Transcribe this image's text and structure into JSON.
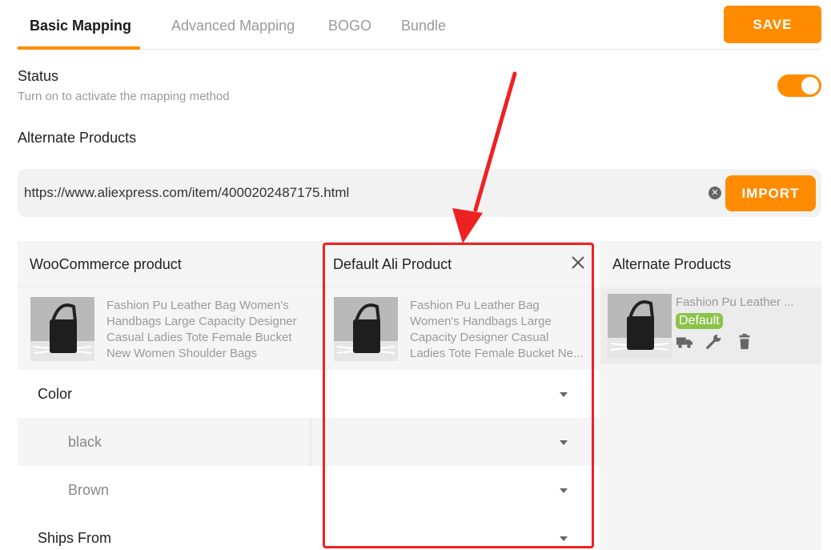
{
  "tabs": [
    {
      "label": "Basic Mapping",
      "active": true
    },
    {
      "label": "Advanced Mapping",
      "active": false
    },
    {
      "label": "BOGO",
      "active": false
    },
    {
      "label": "Bundle",
      "active": false
    }
  ],
  "toolbar": {
    "save_label": "SAVE"
  },
  "status": {
    "title": "Status",
    "description": "Turn on to activate the mapping method",
    "enabled": true
  },
  "alternate_section": {
    "title": "Alternate Products"
  },
  "url_import": {
    "value": "https://www.aliexpress.com/item/4000202487175.html",
    "import_label": "IMPORT"
  },
  "columns": {
    "woo": "WooCommerce product",
    "default_ali": "Default Ali Product",
    "alternate": "Alternate Products"
  },
  "woo_product": {
    "name_lines": [
      "Fashion Pu Leather Bag Women's",
      "Handbags Large Capacity Designer",
      "Casual Ladies Tote Female Bucket",
      "New Women Shoulder Bags"
    ]
  },
  "ali_product": {
    "name_lines": [
      "Fashion Pu Leather Bag",
      "Women's Handbags Large",
      "Capacity Designer Casual",
      "Ladies Tote Female Bucket Ne..."
    ]
  },
  "alternate_item": {
    "name": "Fashion Pu Leather ...",
    "badge": "Default",
    "icons": [
      "truck-icon",
      "wrench-icon",
      "trash-icon"
    ]
  },
  "attributes": [
    {
      "label": "Color",
      "level": 0
    },
    {
      "label": "black",
      "level": 1
    },
    {
      "label": "Brown",
      "level": 1
    },
    {
      "label": "Ships From",
      "level": 0
    }
  ],
  "colors": {
    "accent": "#ff8c00",
    "highlight": "#ee2222",
    "badge": "#8bc34a"
  }
}
